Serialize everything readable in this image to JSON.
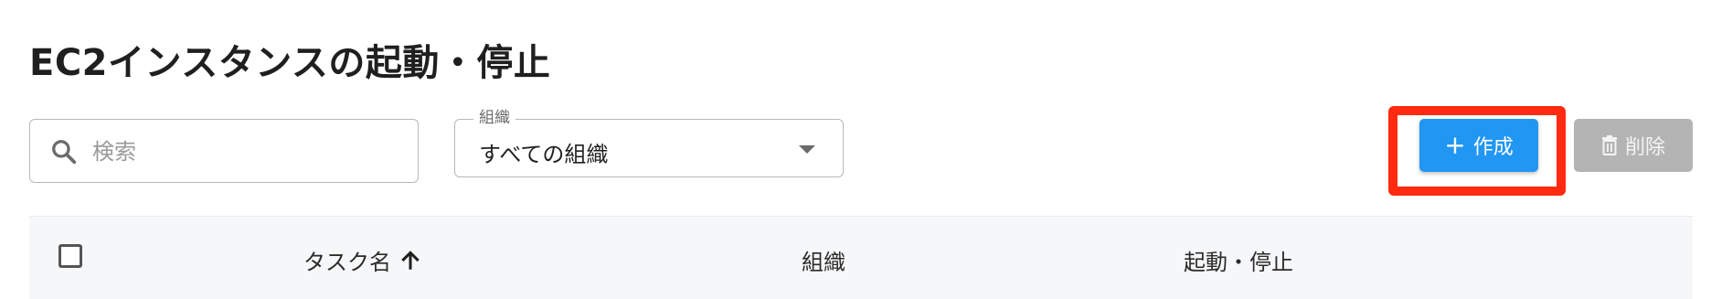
{
  "page": {
    "title": "EC2インスタンスの起動・停止"
  },
  "toolbar": {
    "search_placeholder": "検索",
    "org_select_label": "組織",
    "org_select_value": "すべての組織",
    "create_label": "作成",
    "delete_label": "削除",
    "accent_color": "#2196f3",
    "highlight_color": "#ff2a10"
  },
  "icons": {
    "search": "search-icon",
    "dropdown": "chevron-down-icon",
    "create": "plus-icon",
    "delete": "trash-icon",
    "sort": "arrow-up-icon"
  },
  "table": {
    "columns": [
      {
        "label": "タスク名",
        "sort": "ascending"
      },
      {
        "label": "組織"
      },
      {
        "label": "起動・停止"
      }
    ]
  }
}
